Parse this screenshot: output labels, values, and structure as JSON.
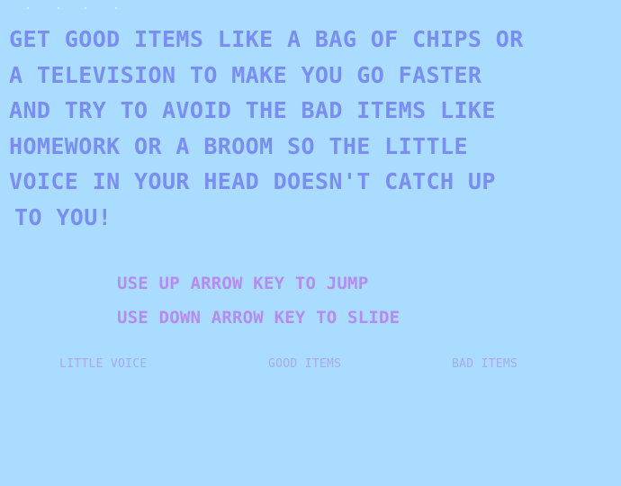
{
  "instructions": {
    "lines": [
      "GET GOOD ITEMS LIKE A BAG OF CHIPS OR",
      "A TELEVISION TO MAKE YOU GO FASTER",
      "AND TRY TO AVOID THE BAD ITEMS LIKE",
      "HOMEWORK OR A BROOM SO THE LITTLE",
      "VOICE IN YOUR HEAD DOESN'T CATCH UP",
      "TO YOU!"
    ]
  },
  "controls": {
    "jump": "USE UP ARROW KEY TO JUMP",
    "slide": "USE DOWN ARROW KEY TO SLIDE"
  },
  "legend": {
    "little_voice": "LITTLE VOICE",
    "good_items": "GOOD ITEMS",
    "bad_items": "BAD ITEMS"
  },
  "colors": {
    "background": "#aadcff",
    "instruction_text": "#7a8ef2",
    "control_text": "#b48cf0",
    "legend_text": "#a8a9f2"
  }
}
